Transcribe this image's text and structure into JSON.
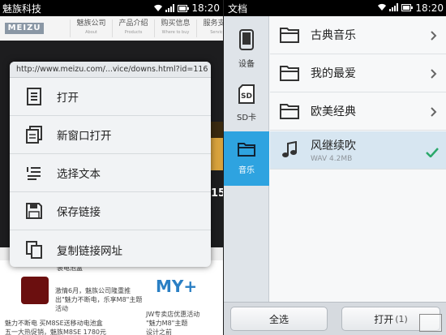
{
  "left": {
    "status": {
      "app": "魅族科技",
      "time": "18:20"
    },
    "web": {
      "logo": "MEIZU",
      "nav": [
        {
          "label": "魅族公司",
          "sub": "About"
        },
        {
          "label": "产品介绍",
          "sub": "Products"
        },
        {
          "label": "购买信息",
          "sub": "Where to buy"
        },
        {
          "label": "服务支持",
          "sub": "Service"
        }
      ],
      "band_number": "15",
      "texts": [
        "装电池盒",
        "激情6月，魅族公司隆重推",
        "出\"魅力不断电，乐享M8\"主题",
        "活动",
        "魅力不断电 买M8SE送移动电池盒",
        "五一大热促销，魅族M8SE 1780元",
        "JW专卖店优惠活动",
        "\"魅力M8\"主题",
        "设计之前"
      ],
      "my_logo": "MY+"
    },
    "popup": {
      "url": "http://www.meizu.com/...vice/downs.html?id=116",
      "items": [
        {
          "label": "打开",
          "icon": "document-icon"
        },
        {
          "label": "新窗口打开",
          "icon": "new-window-icon"
        },
        {
          "label": "选择文本",
          "icon": "select-text-icon"
        },
        {
          "label": "保存链接",
          "icon": "save-icon"
        },
        {
          "label": "复制链接网址",
          "icon": "copy-icon"
        }
      ]
    }
  },
  "right": {
    "status": {
      "app": "文档",
      "time": "18:20"
    },
    "side": [
      {
        "label": "设备",
        "icon": "phone-device-icon",
        "active": false
      },
      {
        "label": "SD卡",
        "icon": "sd-card-icon",
        "active": false
      },
      {
        "label": "音乐",
        "icon": "folder-icon",
        "active": true
      }
    ],
    "rows": [
      {
        "name": "古典音乐",
        "type": "folder"
      },
      {
        "name": "我的最爱",
        "type": "folder"
      },
      {
        "name": "欧美经典",
        "type": "folder"
      },
      {
        "name": "风继续吹",
        "type": "file",
        "sub": "WAV 4.2MB",
        "selected": true
      }
    ],
    "buttons": {
      "select_all": "全选",
      "open": "打开",
      "open_count": "(1)"
    }
  },
  "colors": {
    "accent": "#2ea3e0",
    "selected_row": "#d7e6f1",
    "check": "#2aa86a"
  }
}
